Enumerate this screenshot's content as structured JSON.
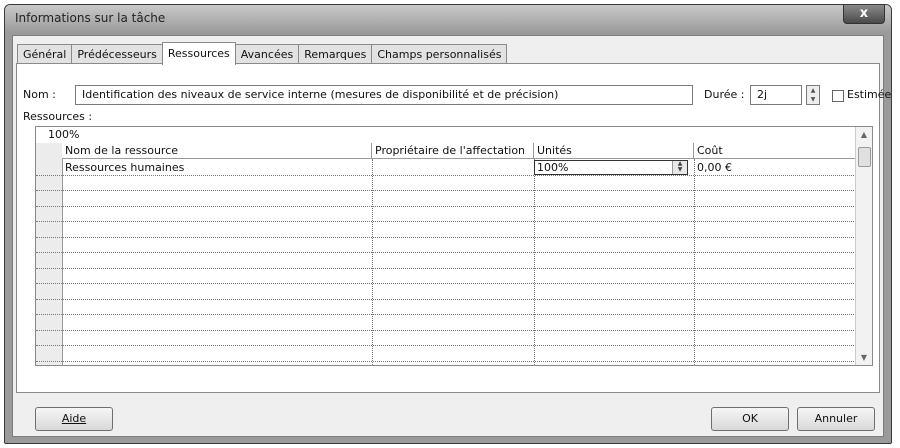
{
  "window": {
    "title": "Informations sur la tâche",
    "close_glyph": "x"
  },
  "tabs": [
    {
      "label": "Général"
    },
    {
      "label": "Prédécesseurs"
    },
    {
      "label": "Ressources"
    },
    {
      "label": "Avancées"
    },
    {
      "label": "Remarques"
    },
    {
      "label": "Champs personnalisés"
    }
  ],
  "active_tab": "Ressources",
  "form": {
    "name_label": "Nom :",
    "name_value": "Identification des niveaux de service interne (mesures de disponibilité et de précision)",
    "duration_label": "Durée :",
    "duration_value": "2j",
    "estimated_label": "Estimée",
    "estimated_checked": false,
    "resources_label": "Ressources :"
  },
  "grid": {
    "edit_value": "100%",
    "columns": [
      "Nom de la ressource",
      "Propriétaire de l'affectation",
      "Unités",
      "Coût"
    ],
    "rows": [
      [
        "Ressources humaines",
        "",
        "100%",
        "0,00 €"
      ]
    ],
    "empty_rows": 13
  },
  "buttons": {
    "help": "Aide",
    "ok": "OK",
    "cancel": "Annuler"
  }
}
